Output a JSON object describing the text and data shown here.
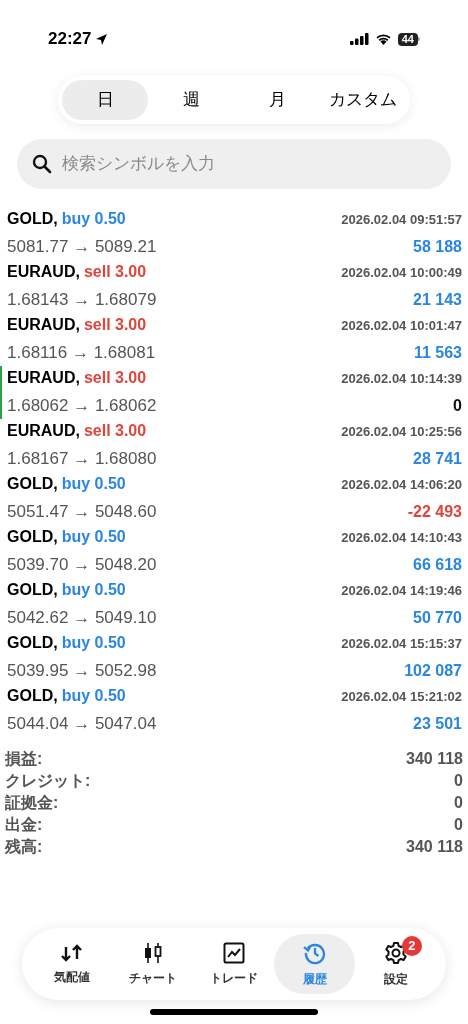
{
  "status_bar": {
    "time": "22:27",
    "battery": "44"
  },
  "period_tabs": [
    {
      "label": "日",
      "selected": true
    },
    {
      "label": "週",
      "selected": false
    },
    {
      "label": "月",
      "selected": false
    },
    {
      "label": "カスタム",
      "selected": false
    }
  ],
  "search": {
    "placeholder": "検索シンボルを入力"
  },
  "deals": [
    {
      "symbol": "GOLD,",
      "kind": "buy",
      "order": "buy 0.50",
      "prices": "5081.77 → 5089.21",
      "time": "2026.02.04 09:51:57",
      "profit": "58 188",
      "color": "#2a86e0",
      "selected": false
    },
    {
      "symbol": "EURAUD,",
      "kind": "sell",
      "order": "sell 3.00",
      "prices": "1.68143 → 1.68079",
      "time": "2026.02.04 10:00:49",
      "profit": "21 143",
      "color": "#2a86e0",
      "selected": false
    },
    {
      "symbol": "EURAUD,",
      "kind": "sell",
      "order": "sell 3.00",
      "prices": "1.68116 → 1.68081",
      "time": "2026.02.04 10:01:47",
      "profit": "11 563",
      "color": "#2a86e0",
      "selected": false
    },
    {
      "symbol": "EURAUD,",
      "kind": "sell",
      "order": "sell 3.00",
      "prices": "1.68062 → 1.68062",
      "time": "2026.02.04 10:14:39",
      "profit": "0",
      "color": "#111111",
      "selected": true
    },
    {
      "symbol": "EURAUD,",
      "kind": "sell",
      "order": "sell 3.00",
      "prices": "1.68167 → 1.68080",
      "time": "2026.02.04 10:25:56",
      "profit": "28 741",
      "color": "#2a86e0",
      "selected": false
    },
    {
      "symbol": "GOLD,",
      "kind": "buy",
      "order": "buy 0.50",
      "prices": "5051.47 → 5048.60",
      "time": "2026.02.04 14:06:20",
      "profit": "-22 493",
      "color": "#e0443a",
      "selected": false
    },
    {
      "symbol": "GOLD,",
      "kind": "buy",
      "order": "buy 0.50",
      "prices": "5039.70 → 5048.20",
      "time": "2026.02.04 14:10:43",
      "profit": "66 618",
      "color": "#2a86e0",
      "selected": false
    },
    {
      "symbol": "GOLD,",
      "kind": "buy",
      "order": "buy 0.50",
      "prices": "5042.62 → 5049.10",
      "time": "2026.02.04 14:19:46",
      "profit": "50 770",
      "color": "#2a86e0",
      "selected": false
    },
    {
      "symbol": "GOLD,",
      "kind": "buy",
      "order": "buy 0.50",
      "prices": "5039.95 → 5052.98",
      "time": "2026.02.04 15:15:37",
      "profit": "102 087",
      "color": "#2a86e0",
      "selected": false
    },
    {
      "symbol": "GOLD,",
      "kind": "buy",
      "order": "buy 0.50",
      "prices": "5044.04 → 5047.04",
      "time": "2026.02.04 15:21:02",
      "profit": "23 501",
      "color": "#2a86e0",
      "selected": false
    }
  ],
  "summary": [
    {
      "label": "損益:",
      "value": "340 118"
    },
    {
      "label": "クレジット:",
      "value": "0"
    },
    {
      "label": "証拠金:",
      "value": "0"
    },
    {
      "label": "出金:",
      "value": "0"
    },
    {
      "label": "残高:",
      "value": "340 118"
    }
  ],
  "tab_bar": [
    {
      "kind": "quotes",
      "label": "気配値",
      "selected": false
    },
    {
      "kind": "chart",
      "label": "チャート",
      "selected": false
    },
    {
      "kind": "trade",
      "label": "トレード",
      "selected": false
    },
    {
      "kind": "history",
      "label": "履歴",
      "selected": true
    },
    {
      "kind": "settings",
      "label": "設定",
      "selected": false,
      "badge": "2"
    }
  ]
}
